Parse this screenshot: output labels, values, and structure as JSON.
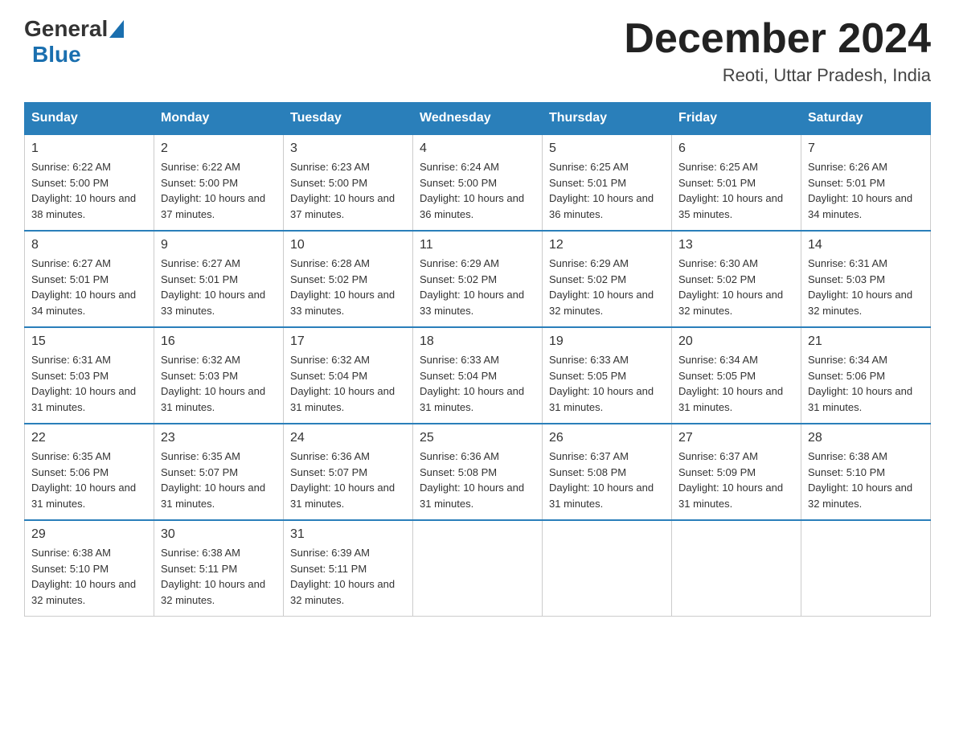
{
  "header": {
    "logo_general": "General",
    "logo_blue": "Blue",
    "month_title": "December 2024",
    "location": "Reoti, Uttar Pradesh, India"
  },
  "days_of_week": [
    "Sunday",
    "Monday",
    "Tuesday",
    "Wednesday",
    "Thursday",
    "Friday",
    "Saturday"
  ],
  "weeks": [
    [
      {
        "day": "1",
        "sunrise": "6:22 AM",
        "sunset": "5:00 PM",
        "daylight": "10 hours and 38 minutes."
      },
      {
        "day": "2",
        "sunrise": "6:22 AM",
        "sunset": "5:00 PM",
        "daylight": "10 hours and 37 minutes."
      },
      {
        "day": "3",
        "sunrise": "6:23 AM",
        "sunset": "5:00 PM",
        "daylight": "10 hours and 37 minutes."
      },
      {
        "day": "4",
        "sunrise": "6:24 AM",
        "sunset": "5:00 PM",
        "daylight": "10 hours and 36 minutes."
      },
      {
        "day": "5",
        "sunrise": "6:25 AM",
        "sunset": "5:01 PM",
        "daylight": "10 hours and 36 minutes."
      },
      {
        "day": "6",
        "sunrise": "6:25 AM",
        "sunset": "5:01 PM",
        "daylight": "10 hours and 35 minutes."
      },
      {
        "day": "7",
        "sunrise": "6:26 AM",
        "sunset": "5:01 PM",
        "daylight": "10 hours and 34 minutes."
      }
    ],
    [
      {
        "day": "8",
        "sunrise": "6:27 AM",
        "sunset": "5:01 PM",
        "daylight": "10 hours and 34 minutes."
      },
      {
        "day": "9",
        "sunrise": "6:27 AM",
        "sunset": "5:01 PM",
        "daylight": "10 hours and 33 minutes."
      },
      {
        "day": "10",
        "sunrise": "6:28 AM",
        "sunset": "5:02 PM",
        "daylight": "10 hours and 33 minutes."
      },
      {
        "day": "11",
        "sunrise": "6:29 AM",
        "sunset": "5:02 PM",
        "daylight": "10 hours and 33 minutes."
      },
      {
        "day": "12",
        "sunrise": "6:29 AM",
        "sunset": "5:02 PM",
        "daylight": "10 hours and 32 minutes."
      },
      {
        "day": "13",
        "sunrise": "6:30 AM",
        "sunset": "5:02 PM",
        "daylight": "10 hours and 32 minutes."
      },
      {
        "day": "14",
        "sunrise": "6:31 AM",
        "sunset": "5:03 PM",
        "daylight": "10 hours and 32 minutes."
      }
    ],
    [
      {
        "day": "15",
        "sunrise": "6:31 AM",
        "sunset": "5:03 PM",
        "daylight": "10 hours and 31 minutes."
      },
      {
        "day": "16",
        "sunrise": "6:32 AM",
        "sunset": "5:03 PM",
        "daylight": "10 hours and 31 minutes."
      },
      {
        "day": "17",
        "sunrise": "6:32 AM",
        "sunset": "5:04 PM",
        "daylight": "10 hours and 31 minutes."
      },
      {
        "day": "18",
        "sunrise": "6:33 AM",
        "sunset": "5:04 PM",
        "daylight": "10 hours and 31 minutes."
      },
      {
        "day": "19",
        "sunrise": "6:33 AM",
        "sunset": "5:05 PM",
        "daylight": "10 hours and 31 minutes."
      },
      {
        "day": "20",
        "sunrise": "6:34 AM",
        "sunset": "5:05 PM",
        "daylight": "10 hours and 31 minutes."
      },
      {
        "day": "21",
        "sunrise": "6:34 AM",
        "sunset": "5:06 PM",
        "daylight": "10 hours and 31 minutes."
      }
    ],
    [
      {
        "day": "22",
        "sunrise": "6:35 AM",
        "sunset": "5:06 PM",
        "daylight": "10 hours and 31 minutes."
      },
      {
        "day": "23",
        "sunrise": "6:35 AM",
        "sunset": "5:07 PM",
        "daylight": "10 hours and 31 minutes."
      },
      {
        "day": "24",
        "sunrise": "6:36 AM",
        "sunset": "5:07 PM",
        "daylight": "10 hours and 31 minutes."
      },
      {
        "day": "25",
        "sunrise": "6:36 AM",
        "sunset": "5:08 PM",
        "daylight": "10 hours and 31 minutes."
      },
      {
        "day": "26",
        "sunrise": "6:37 AM",
        "sunset": "5:08 PM",
        "daylight": "10 hours and 31 minutes."
      },
      {
        "day": "27",
        "sunrise": "6:37 AM",
        "sunset": "5:09 PM",
        "daylight": "10 hours and 31 minutes."
      },
      {
        "day": "28",
        "sunrise": "6:38 AM",
        "sunset": "5:10 PM",
        "daylight": "10 hours and 32 minutes."
      }
    ],
    [
      {
        "day": "29",
        "sunrise": "6:38 AM",
        "sunset": "5:10 PM",
        "daylight": "10 hours and 32 minutes."
      },
      {
        "day": "30",
        "sunrise": "6:38 AM",
        "sunset": "5:11 PM",
        "daylight": "10 hours and 32 minutes."
      },
      {
        "day": "31",
        "sunrise": "6:39 AM",
        "sunset": "5:11 PM",
        "daylight": "10 hours and 32 minutes."
      },
      null,
      null,
      null,
      null
    ]
  ]
}
